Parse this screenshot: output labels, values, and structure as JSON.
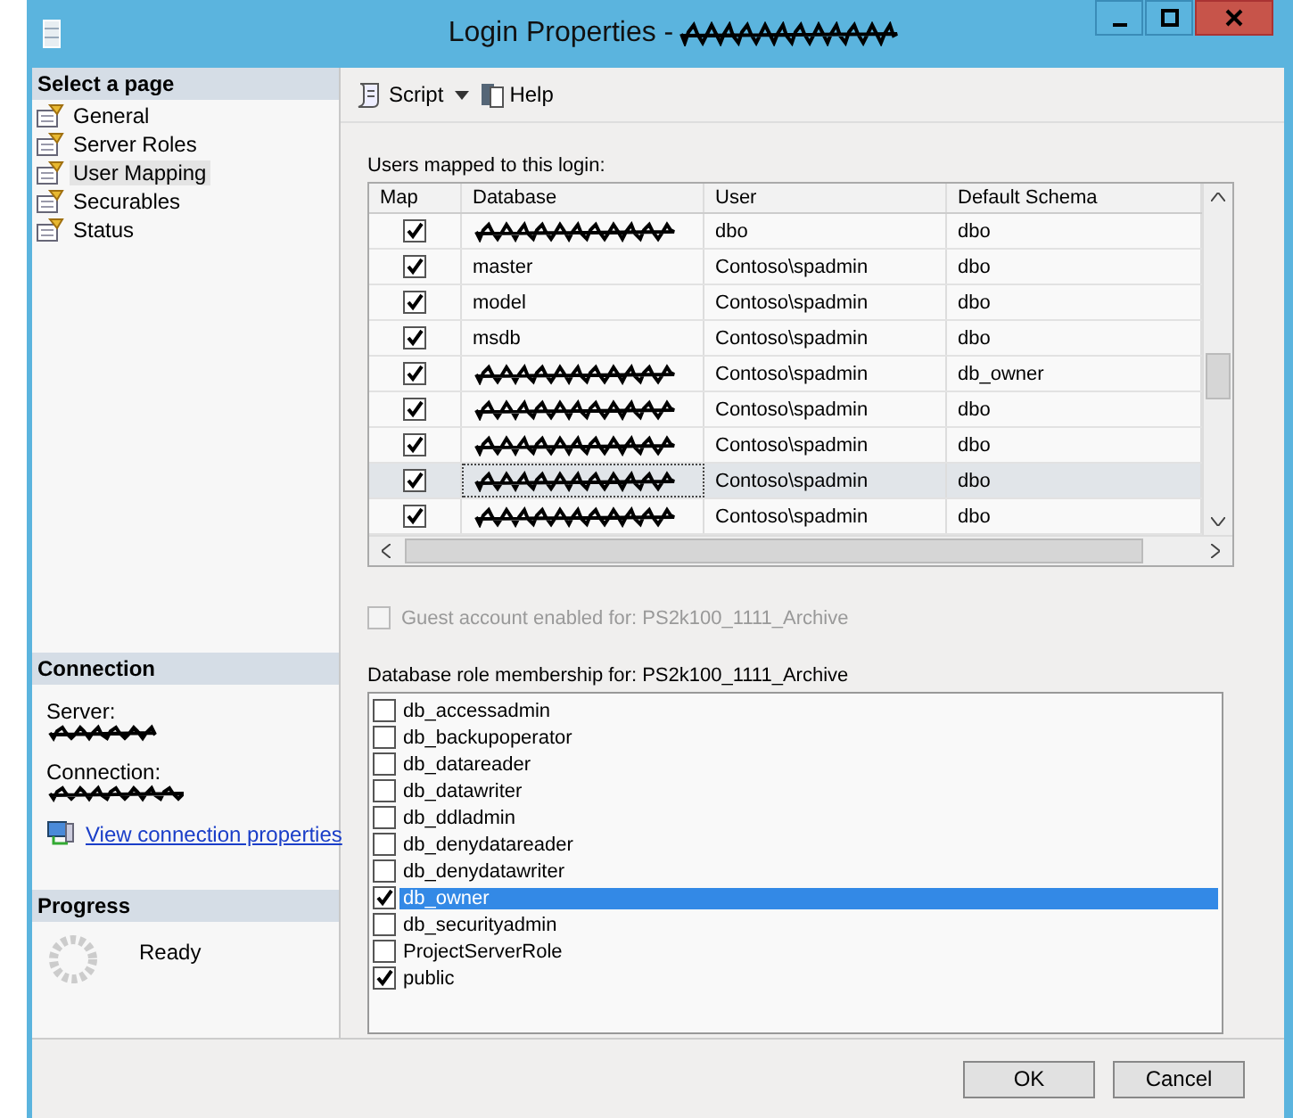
{
  "window": {
    "title": "Login Properties - ",
    "title_redacted": true
  },
  "select_page": {
    "header": "Select a page",
    "items": [
      {
        "label": "General",
        "selected": false
      },
      {
        "label": "Server Roles",
        "selected": false
      },
      {
        "label": "User Mapping",
        "selected": true
      },
      {
        "label": "Securables",
        "selected": false
      },
      {
        "label": "Status",
        "selected": false
      }
    ]
  },
  "connection": {
    "header": "Connection",
    "server_label": "Server:",
    "connection_label": "Connection:",
    "link": "View connection properties"
  },
  "progress": {
    "header": "Progress",
    "status": "Ready"
  },
  "toolbar": {
    "script": "Script",
    "help": "Help"
  },
  "users_mapped": {
    "label": "Users mapped to this login:",
    "columns": [
      "Map",
      "Database",
      "User",
      "Default Schema"
    ],
    "rows": [
      {
        "map": true,
        "redacted": true,
        "user": "dbo",
        "default_schema": "dbo",
        "selected": false
      },
      {
        "map": true,
        "database": "master",
        "user": "Contoso\\spadmin",
        "default_schema": "dbo",
        "selected": false
      },
      {
        "map": true,
        "database": "model",
        "user": "Contoso\\spadmin",
        "default_schema": "dbo",
        "selected": false
      },
      {
        "map": true,
        "database": "msdb",
        "user": "Contoso\\spadmin",
        "default_schema": "dbo",
        "selected": false
      },
      {
        "map": true,
        "redacted": true,
        "user": "Contoso\\spadmin",
        "default_schema": "db_owner",
        "selected": false
      },
      {
        "map": true,
        "redacted": true,
        "user": "Contoso\\spadmin",
        "default_schema": "dbo",
        "selected": false
      },
      {
        "map": true,
        "redacted": true,
        "user": "Contoso\\spadmin",
        "default_schema": "dbo",
        "selected": false
      },
      {
        "map": true,
        "redacted": true,
        "user": "Contoso\\spadmin",
        "default_schema": "dbo",
        "selected": true
      },
      {
        "map": true,
        "redacted": true,
        "user": "Contoso\\spadmin",
        "default_schema": "dbo",
        "selected": false
      }
    ]
  },
  "guest": {
    "label": "Guest account enabled for: PS2k100_1111_Archive",
    "checked": false,
    "disabled": true
  },
  "roles": {
    "label": "Database role membership for: PS2k100_1111_Archive",
    "items": [
      {
        "name": "db_accessadmin",
        "checked": false,
        "selected": false
      },
      {
        "name": "db_backupoperator",
        "checked": false,
        "selected": false
      },
      {
        "name": "db_datareader",
        "checked": false,
        "selected": false
      },
      {
        "name": "db_datawriter",
        "checked": false,
        "selected": false
      },
      {
        "name": "db_ddladmin",
        "checked": false,
        "selected": false
      },
      {
        "name": "db_denydatareader",
        "checked": false,
        "selected": false
      },
      {
        "name": "db_denydatawriter",
        "checked": false,
        "selected": false
      },
      {
        "name": "db_owner",
        "checked": true,
        "selected": true
      },
      {
        "name": "db_securityadmin",
        "checked": false,
        "selected": false
      },
      {
        "name": "ProjectServerRole",
        "checked": false,
        "selected": false
      },
      {
        "name": "public",
        "checked": true,
        "selected": false
      }
    ]
  },
  "buttons": [
    "OK",
    "Cancel"
  ]
}
